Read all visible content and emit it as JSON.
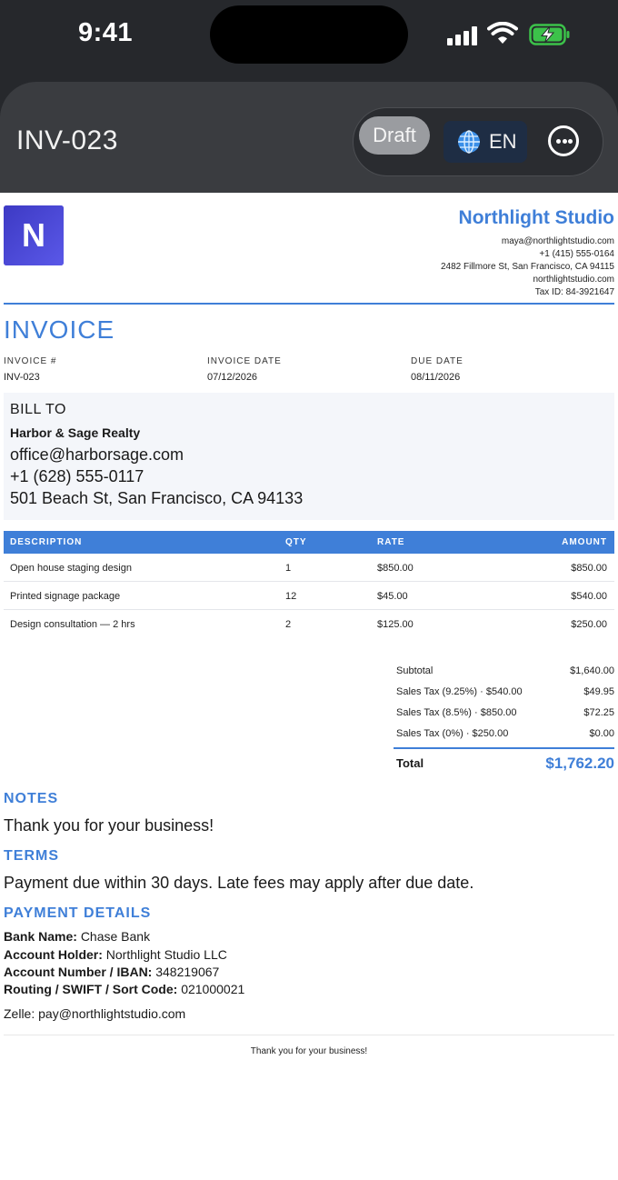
{
  "status_bar": {
    "time": "9:41"
  },
  "nav": {
    "title": "INV-023",
    "status_badge": "Draft",
    "language": "EN"
  },
  "colors": {
    "accent": "#3f7fd8",
    "logo": "#4d4bd9",
    "nav_bg": "#3a3c40"
  },
  "company": {
    "logo_letter": "N",
    "name": "Northlight Studio",
    "email": "maya@northlightstudio.com",
    "phone": "+1 (415) 555-0164",
    "address": "2482 Fillmore St, San Francisco, CA 94115",
    "website": "northlightstudio.com",
    "tax_id": "Tax ID: 84-3921647"
  },
  "invoice": {
    "heading": "INVOICE",
    "number_label": "INVOICE #",
    "number": "INV-023",
    "date_label": "INVOICE DATE",
    "date": "07/12/2026",
    "due_label": "DUE DATE",
    "due": "08/11/2026"
  },
  "bill_to": {
    "heading": "BILL TO",
    "name": "Harbor & Sage Realty",
    "email": "office@harborsage.com",
    "phone": "+1 (628) 555-0117",
    "address": "501 Beach St, San Francisco, CA 94133"
  },
  "table": {
    "headers": {
      "description": "DESCRIPTION",
      "qty": "QTY",
      "rate": "RATE",
      "amount": "AMOUNT"
    },
    "rows": [
      {
        "description": "Open house staging design",
        "qty": "1",
        "rate": "$850.00",
        "amount": "$850.00"
      },
      {
        "description": "Printed signage package",
        "qty": "12",
        "rate": "$45.00",
        "amount": "$540.00"
      },
      {
        "description": "Design consultation — 2 hrs",
        "qty": "2",
        "rate": "$125.00",
        "amount": "$250.00"
      }
    ]
  },
  "summary": {
    "lines": [
      {
        "label": "Subtotal",
        "value": "$1,640.00"
      },
      {
        "label": "Sales Tax (9.25%) · $540.00",
        "value": "$49.95"
      },
      {
        "label": "Sales Tax (8.5%) · $850.00",
        "value": "$72.25"
      },
      {
        "label": "Sales Tax (0%) · $250.00",
        "value": "$0.00"
      }
    ],
    "total_label": "Total",
    "total_value": "$1,762.20"
  },
  "notes": {
    "heading": "NOTES",
    "text": "Thank you for your business!"
  },
  "terms": {
    "heading": "TERMS",
    "text": "Payment due within 30 days. Late fees may apply after due date."
  },
  "payment": {
    "heading": "PAYMENT DETAILS",
    "bank_label": "Bank Name:",
    "bank": "Chase Bank",
    "holder_label": "Account Holder:",
    "holder": "Northlight Studio LLC",
    "account_label": "Account Number / IBAN:",
    "account": "348219067",
    "routing_label": "Routing / SWIFT / Sort Code:",
    "routing": "021000021",
    "zelle": "Zelle: pay@northlightstudio.com"
  },
  "footer": {
    "text": "Thank you for your business!"
  }
}
